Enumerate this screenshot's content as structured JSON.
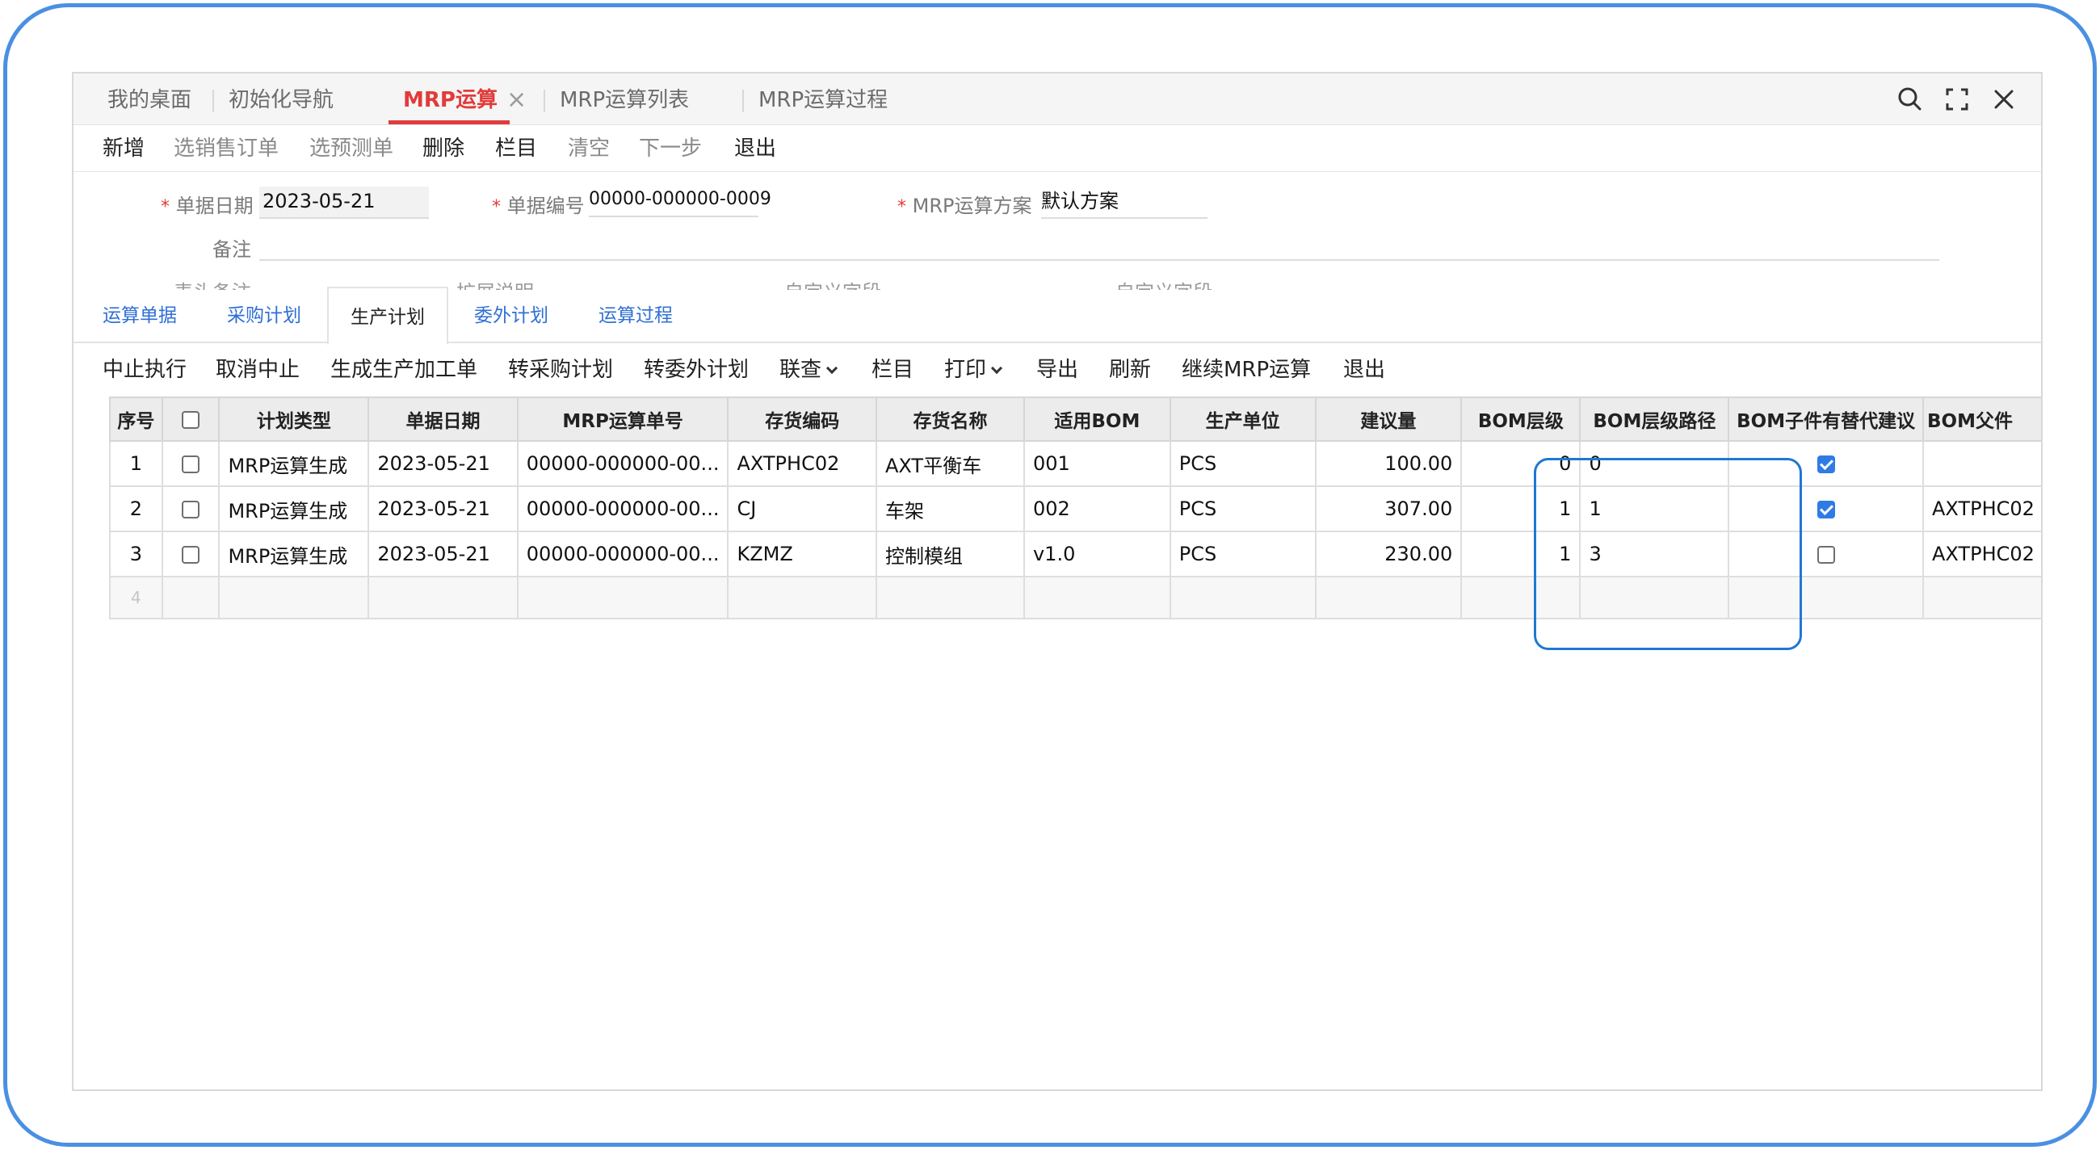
{
  "tabs": [
    {
      "label": "我的桌面"
    },
    {
      "label": "初始化导航"
    },
    {
      "label": "MRP运算",
      "close": "×"
    },
    {
      "label": "MRP运算列表"
    },
    {
      "label": "MRP运算过程"
    }
  ],
  "window_controls": [
    "search-icon",
    "fullscreen-icon",
    "close-icon"
  ],
  "toolbar1": [
    "新增",
    "选销售订单",
    "选预测单",
    "删除",
    "栏目",
    "清空",
    "下一步",
    "退出"
  ],
  "form": {
    "required_mark": "*",
    "date_label": "单据日期",
    "date_value": "2023-05-21",
    "number_label": "单据编号",
    "number_value": "00000-000000-0009",
    "scheme_label": "MRP运算方案",
    "scheme_value": "默认方案",
    "remark_label": "备注",
    "remark_value": "",
    "ghost_labels": [
      "表头备注",
      "扩展说明",
      "自定义字段",
      "自定义字段"
    ]
  },
  "subtabs": [
    "运算单据",
    "采购计划",
    "生产计划",
    "委外计划",
    "运算过程"
  ],
  "toolbar2": [
    "中止执行",
    "取消中止",
    "生成生产加工单",
    "转采购计划",
    "转委外计划",
    "联查",
    "栏目",
    "打印",
    "导出",
    "刷新",
    "继续MRP运算",
    "退出"
  ],
  "table": {
    "headers": [
      "序号",
      "",
      "计划类型",
      "单据日期",
      "MRP运算单号",
      "存货编码",
      "存货名称",
      "适用BOM",
      "生产单位",
      "建议量",
      "BOM层级",
      "BOM层级路径",
      "BOM子件有替代建议",
      "BOM父件"
    ],
    "rows": [
      {
        "seq": "1",
        "type": "MRP运算生成",
        "date": "2023-05-21",
        "mrp_no": "00000-000000-00...",
        "code": "AXTPHC02",
        "name": "AXT平衡车",
        "bom": "001",
        "unit": "PCS",
        "qty": "100.00",
        "level": "0",
        "path": "0",
        "substitute": true,
        "parent": ""
      },
      {
        "seq": "2",
        "type": "MRP运算生成",
        "date": "2023-05-21",
        "mrp_no": "00000-000000-00...",
        "code": "CJ",
        "name": "车架",
        "bom": "002",
        "unit": "PCS",
        "qty": "307.00",
        "level": "1",
        "path": "1",
        "substitute": true,
        "parent": "AXTPHC02"
      },
      {
        "seq": "3",
        "type": "MRP运算生成",
        "date": "2023-05-21",
        "mrp_no": "00000-000000-00...",
        "code": "KZMZ",
        "name": "控制模组",
        "bom": "v1.0",
        "unit": "PCS",
        "qty": "230.00",
        "level": "1",
        "path": "3",
        "substitute": false,
        "parent": "AXTPHC02"
      }
    ],
    "empty_row_seq": "4"
  },
  "colors": {
    "accent_red": "#e23b3b",
    "link_blue": "#2f6fd6",
    "highlight_blue": "#1f78d1",
    "checkbox_blue": "#2f7be6"
  }
}
